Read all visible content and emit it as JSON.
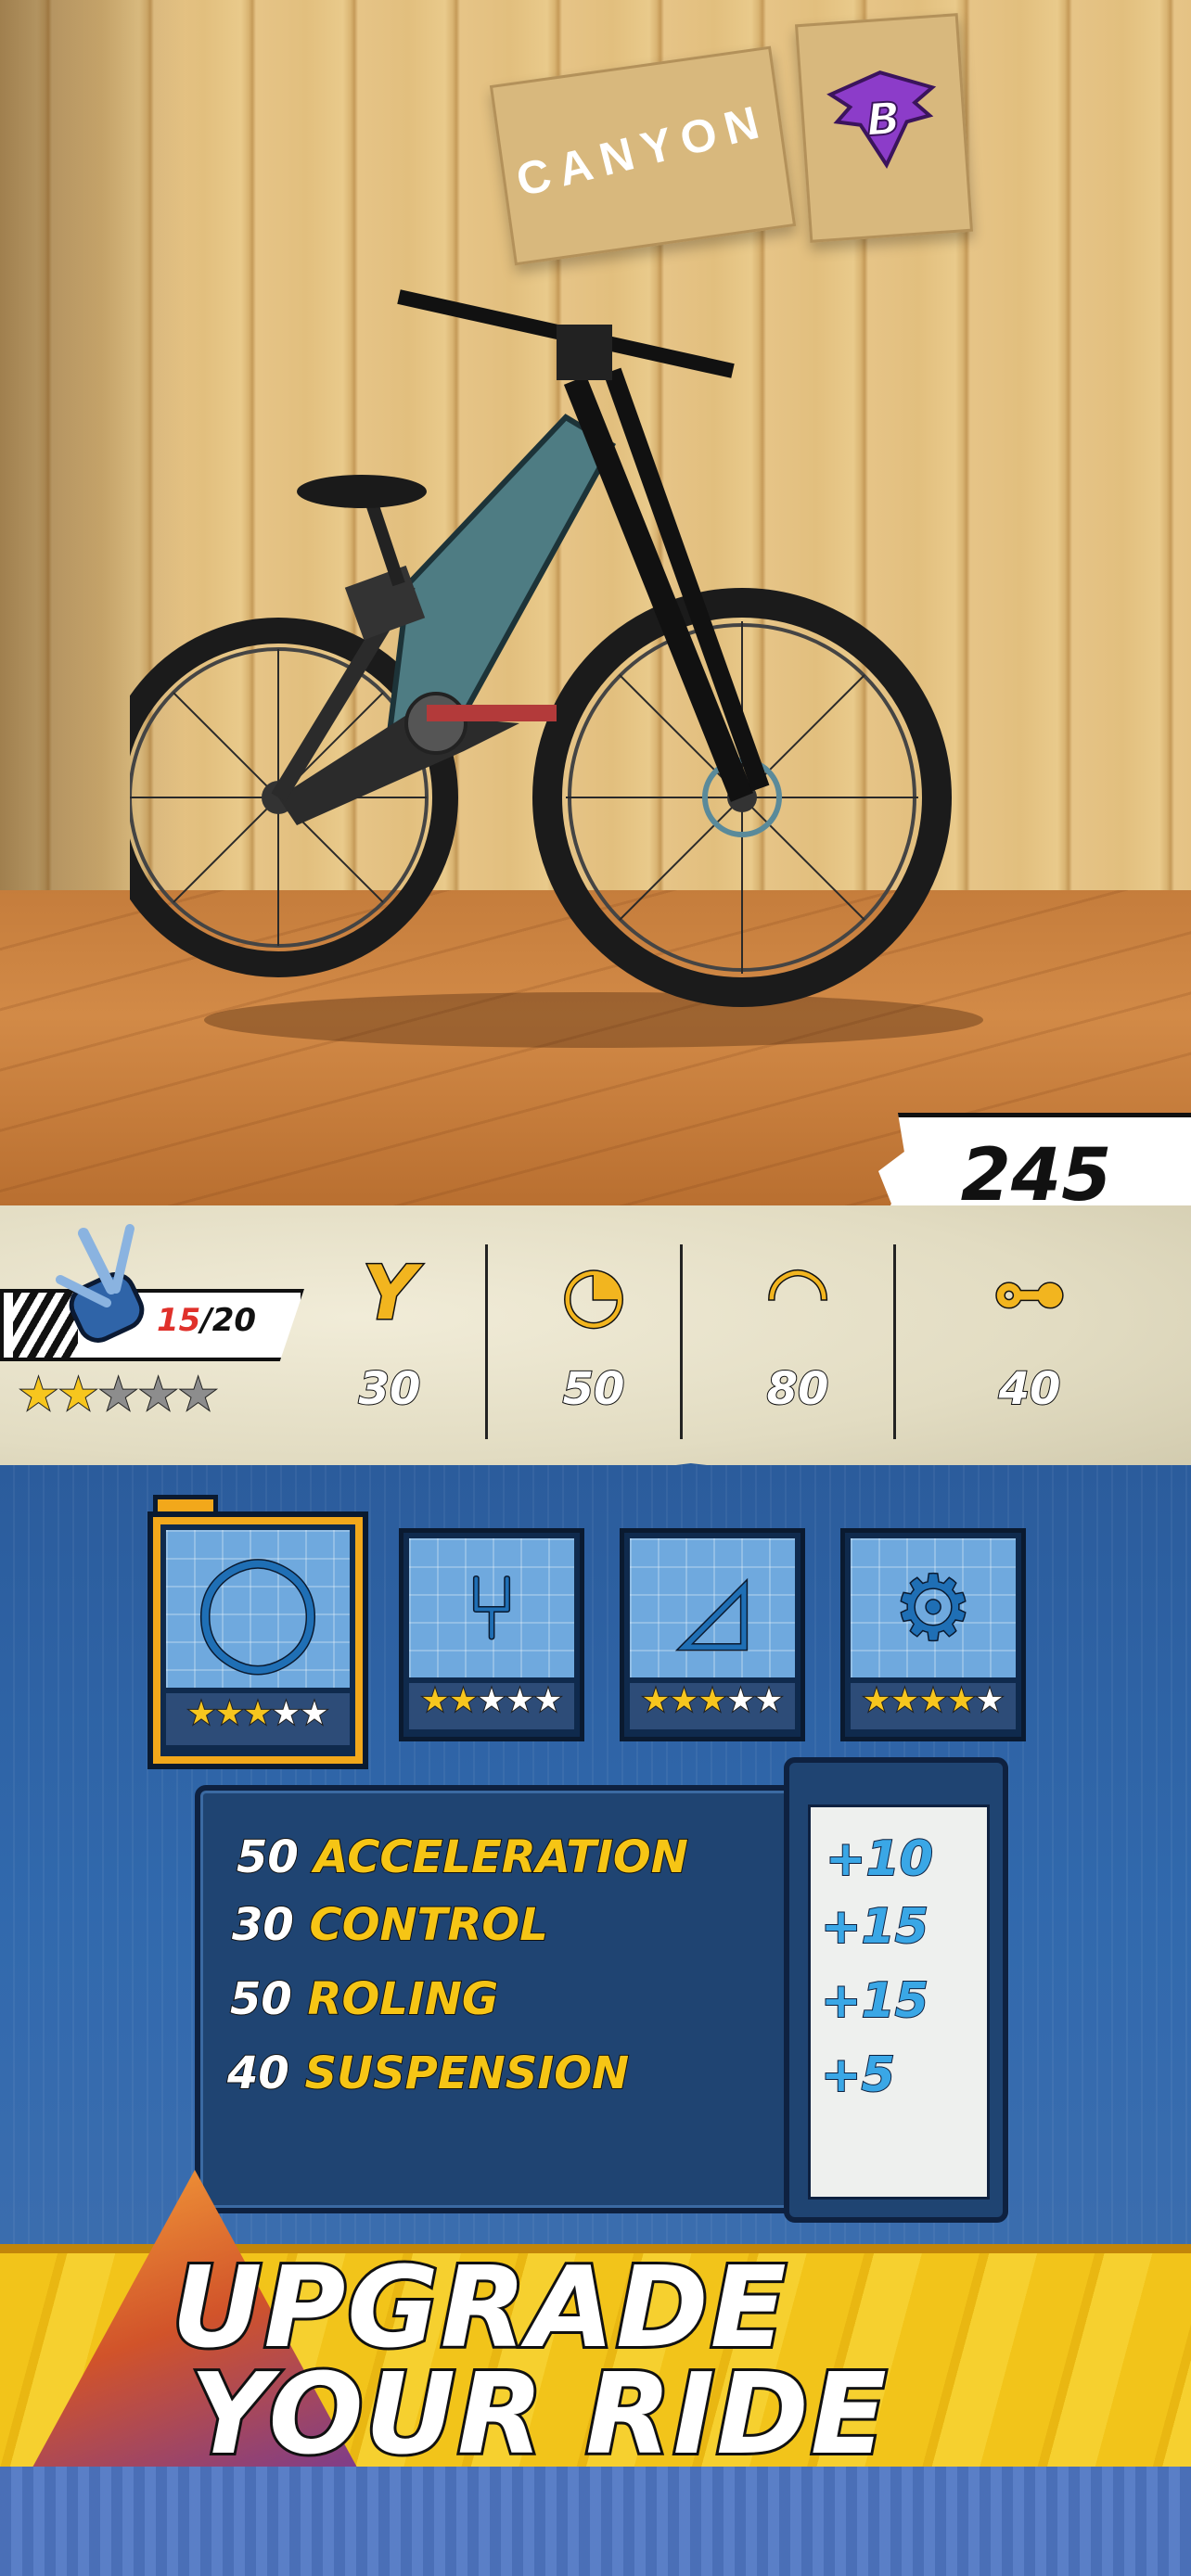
{
  "scene": {
    "board_brand": "CANYON",
    "board_logo_letter": "B",
    "colors": {
      "logo": "#8c3cc9",
      "bike_frame": "#4e7c83"
    }
  },
  "score": {
    "value": "245"
  },
  "level": {
    "current": "15",
    "max": "20",
    "stars_filled": 2,
    "stars_total": 5
  },
  "stats": [
    {
      "icon": "fork-icon",
      "glyph": "Y",
      "value": "30"
    },
    {
      "icon": "speedometer-icon",
      "glyph": "◔",
      "value": "50"
    },
    {
      "icon": "tire-icon",
      "glyph": "◠",
      "value": "80"
    },
    {
      "icon": "shock-icon",
      "glyph": "⊶",
      "value": "40"
    }
  ],
  "parts": [
    {
      "name": "tire",
      "glyph": "◯",
      "stars_filled": 3,
      "stars_total": 5,
      "selected": true
    },
    {
      "name": "fork",
      "glyph": "⑂",
      "stars_filled": 2,
      "stars_total": 5,
      "selected": false
    },
    {
      "name": "frame",
      "glyph": "◿",
      "stars_filled": 3,
      "stars_total": 5,
      "selected": false
    },
    {
      "name": "drivetrain",
      "glyph": "⚙",
      "stars_filled": 4,
      "stars_total": 5,
      "selected": false
    }
  ],
  "upgrade_rows": [
    {
      "value": "50",
      "label": "ACCELERATION",
      "bonus": "+10"
    },
    {
      "value": "30",
      "label": "CONTROL",
      "bonus": "+15"
    },
    {
      "value": "50",
      "label": "ROLING",
      "bonus": "+15"
    },
    {
      "value": "40",
      "label": "SUSPENSION",
      "bonus": "+5"
    }
  ],
  "headline": {
    "line1": "UPGRADE",
    "line2": "YOUR RIDE"
  }
}
